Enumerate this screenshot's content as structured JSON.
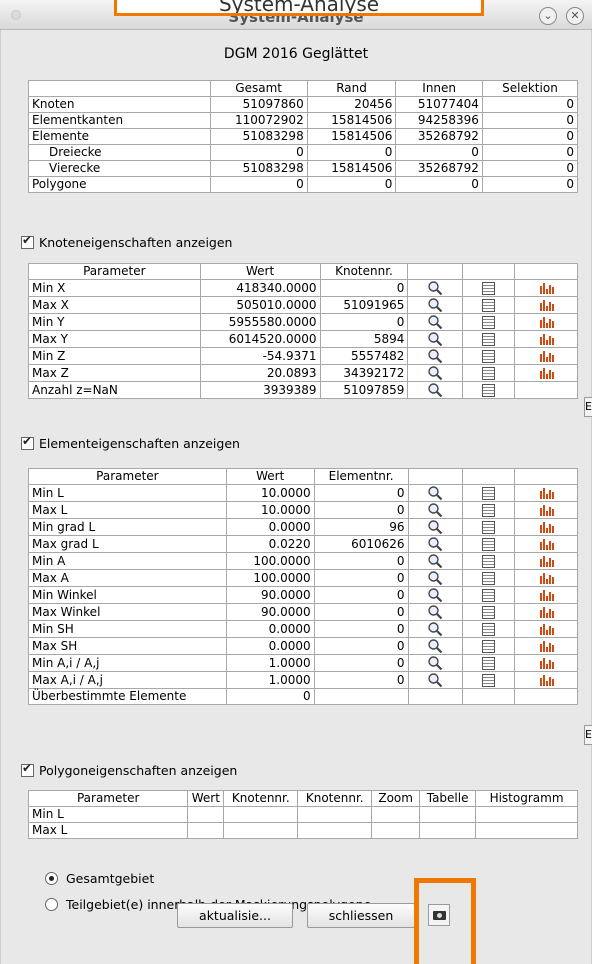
{
  "window": {
    "title": "System-Analyse",
    "callout_text": "System-Analyse"
  },
  "heading": "DGM 2016 Geglättet",
  "summary": {
    "columns": [
      "",
      "Gesamt",
      "Rand",
      "Innen",
      "Selektion"
    ],
    "rows": [
      [
        "Knoten",
        "51097860",
        "20456",
        "51077404",
        "0"
      ],
      [
        "Elementkanten",
        "110072902",
        "15814506",
        "94258396",
        "0"
      ],
      [
        "Elemente",
        "51083298",
        "15814506",
        "35268792",
        "0"
      ],
      [
        "Dreiecke",
        "0",
        "0",
        "0",
        "0"
      ],
      [
        "Vierecke",
        "51083298",
        "15814506",
        "35268792",
        "0"
      ],
      [
        "Polygone",
        "0",
        "0",
        "0",
        "0"
      ]
    ]
  },
  "node_section": {
    "checkbox_label": "Knoteneigenschaften anzeigen",
    "columns": [
      "Parameter",
      "Wert",
      "Knotennr.",
      "",
      "",
      ""
    ],
    "rows": [
      [
        "Min X",
        "418340.0000",
        "0"
      ],
      [
        "Max X",
        "505010.0000",
        "51091965"
      ],
      [
        "Min Y",
        "5955580.0000",
        "0"
      ],
      [
        "Max Y",
        "6014520.0000",
        "5894"
      ],
      [
        "Min Z",
        "-54.9371",
        "5557482"
      ],
      [
        "Max Z",
        "20.0893",
        "34392172"
      ],
      [
        "Anzahl z=NaN",
        "3939389",
        "51097859"
      ]
    ],
    "side_button": "E"
  },
  "element_section": {
    "checkbox_label": "Elementeigenschaften anzeigen",
    "columns": [
      "Parameter",
      "Wert",
      "Elementnr.",
      "",
      "",
      ""
    ],
    "rows": [
      [
        "Min L",
        "10.0000",
        "0"
      ],
      [
        "Max L",
        "10.0000",
        "0"
      ],
      [
        "Min grad L",
        "0.0000",
        "96"
      ],
      [
        "Max grad L",
        "0.0220",
        "6010626"
      ],
      [
        "Min A",
        "100.0000",
        "0"
      ],
      [
        "Max A",
        "100.0000",
        "0"
      ],
      [
        "Min Winkel",
        "90.0000",
        "0"
      ],
      [
        "Max Winkel",
        "90.0000",
        "0"
      ],
      [
        "Min SH",
        "0.0000",
        "0"
      ],
      [
        "Max SH",
        "0.0000",
        "0"
      ],
      [
        "Min A,i / A,j",
        "1.0000",
        "0"
      ],
      [
        "Max A,i / A,j",
        "1.0000",
        "0"
      ]
    ],
    "last_row": [
      "Überbestimmte Elemente",
      "0"
    ],
    "side_button": "E"
  },
  "polygon_section": {
    "checkbox_label": "Polygoneigenschaften anzeigen",
    "columns": [
      "Parameter",
      "Wert",
      "Knotennr.",
      "Knotennr.",
      "Zoom",
      "Tabelle",
      "Histogramm"
    ],
    "rows": [
      [
        "Min L"
      ],
      [
        "Max L"
      ]
    ]
  },
  "scope": {
    "options": [
      "Gesamtgebiet",
      "Teilgebiet(e) innerhalb der Maskierungspolygone"
    ],
    "selected": "Gesamtgebiet"
  },
  "buttons": {
    "refresh": "aktualisie...",
    "close": "schliessen"
  },
  "icons": {
    "zoom": "magnifier-icon",
    "table": "table-icon",
    "histogram": "histogram-icon",
    "camera": "camera-icon"
  },
  "colors": {
    "highlight": "#f07800",
    "histogram": "#d34a10"
  }
}
